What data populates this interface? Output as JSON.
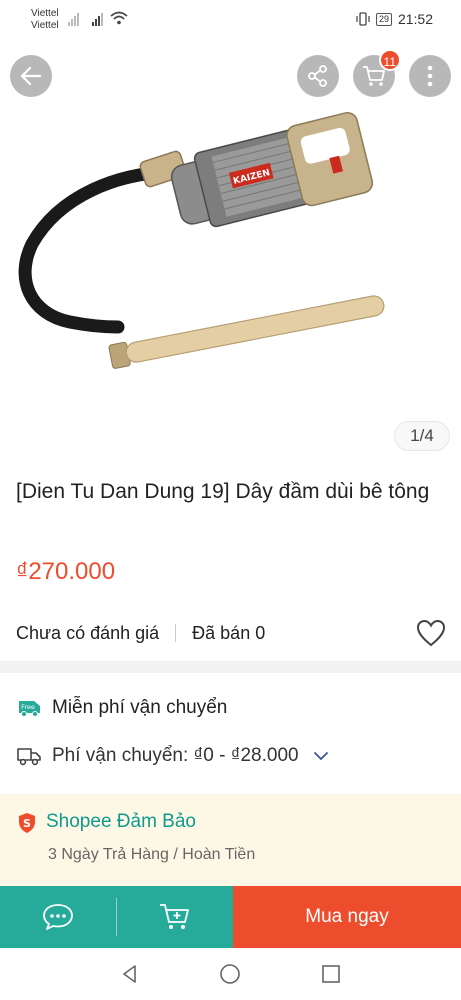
{
  "status_bar": {
    "carrier_1": "Viettel",
    "carrier_2": "Viettel",
    "battery": "29",
    "time": "21:52"
  },
  "header": {
    "cart_count": "11",
    "icons": [
      "arrow-left-icon",
      "share-icon",
      "cart-icon",
      "more-vertical-icon"
    ]
  },
  "gallery": {
    "counter": "1/4",
    "current_index": 1,
    "total": 4
  },
  "product": {
    "title": "[Dien Tu Dan Dung 19] Dây đầm dùi bê tông",
    "price": "₫270.000",
    "rating_text": "Chưa có đánh giá",
    "sold_text": "Đã bán 0"
  },
  "shipping": {
    "free_badge": "Free",
    "free_label": "Miễn phí vận chuyển",
    "fee_label": "Phí vận chuyển: ₫0 - ₫28.000"
  },
  "guarantee": {
    "title": "Shopee Đảm Bảo",
    "subtitle": "3 Ngày Trả Hàng / Hoàn Tiền"
  },
  "actions": {
    "buy_now": "Mua ngay"
  },
  "colors": {
    "primary": "#ee4d2d",
    "teal": "#26aa99",
    "guarantee_bg": "#fdf8e6"
  }
}
